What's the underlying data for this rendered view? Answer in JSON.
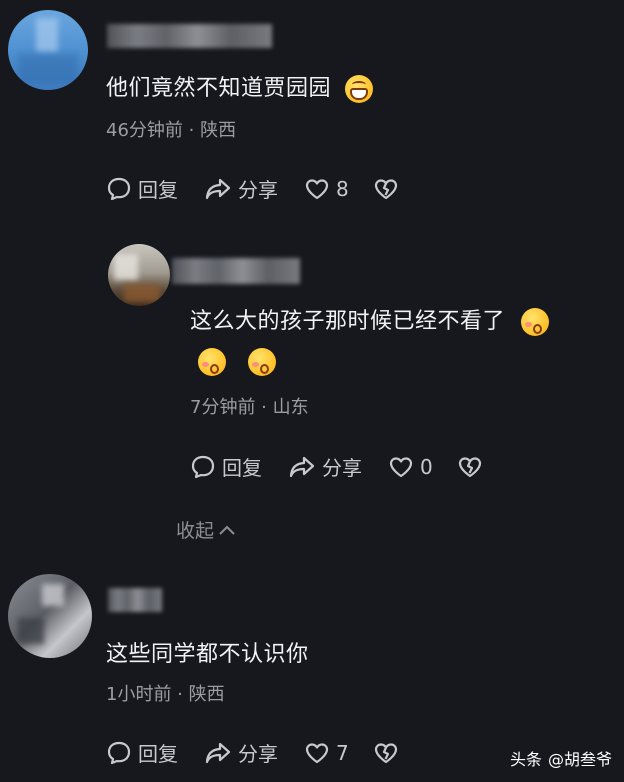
{
  "comments": [
    {
      "content": "他们竟然不知道贾园园",
      "meta": "46分钟前 · 陕西",
      "reply_label": "回复",
      "share_label": "分享",
      "like_count": "8"
    },
    {
      "content": "这么大的孩子那时候已经不看了",
      "meta": "7分钟前 · 山东",
      "reply_label": "回复",
      "share_label": "分享",
      "like_count": "0"
    },
    {
      "content": "这些同学都不认识你",
      "meta": "1小时前 · 陕西",
      "reply_label": "回复",
      "share_label": "分享",
      "like_count": "7"
    }
  ],
  "collapse_label": "收起",
  "watermark": {
    "brand": "头条",
    "handle": "@胡叁爷"
  },
  "icons": [
    "reply-icon",
    "share-icon",
    "like-icon",
    "dislike-icon",
    "chevron-up-icon"
  ]
}
